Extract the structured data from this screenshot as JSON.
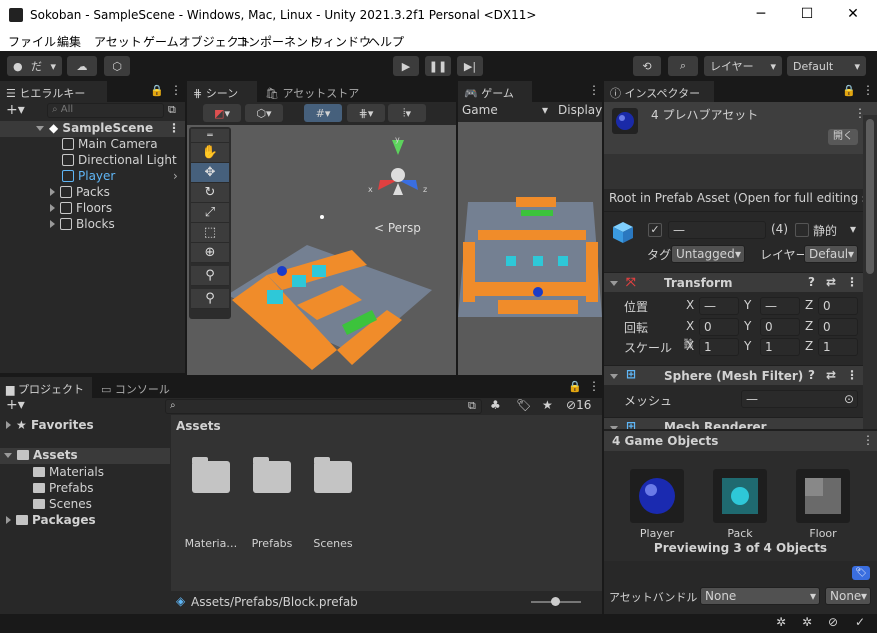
{
  "window": {
    "title": "Sokoban - SampleScene - Windows, Mac, Linux - Unity 2021.3.2f1 Personal <DX11>",
    "min": "─",
    "max": "☐",
    "close": "✕"
  },
  "menu": [
    "ファイル",
    "編集",
    "アセット",
    "ゲームオブジェクト",
    "コンポーネント",
    "ウィンドウ",
    "ヘルプ"
  ],
  "toolbar": {
    "account": "だ",
    "layers": "レイヤー",
    "layout": "Default"
  },
  "hierarchy": {
    "tab": "ヒエラルキー",
    "search_placeholder": "All",
    "scene": "SampleScene",
    "items": [
      "Main Camera",
      "Directional Light",
      "Player",
      "Packs",
      "Floors",
      "Blocks"
    ]
  },
  "scene": {
    "tab": "シーン",
    "tab2": "アセットストア",
    "persp": "< Persp",
    "gizmo_x": "x",
    "gizmo_y": "y",
    "gizmo_z": "z"
  },
  "game": {
    "tab": "ゲーム",
    "display": "Game",
    "display2": "Display"
  },
  "inspector": {
    "tab": "インスペクター",
    "title": "4 プレハブアセット",
    "open_btn": "開く",
    "root_text": "Root in Prefab Asset (Open for full editing s",
    "name_field": "—",
    "count": "(4)",
    "static_label": "静的",
    "tag_label": "タグ",
    "tag_value": "Untagged",
    "layer_label": "レイヤー",
    "layer_value": "Defaul",
    "transform": "Transform",
    "pos_label": "位置",
    "rot_label": "回転",
    "scale_label": "スケール",
    "pos": [
      "—",
      "—",
      "0"
    ],
    "rot": [
      "0",
      "0",
      "0"
    ],
    "scale": [
      "1",
      "1",
      "1"
    ],
    "x": "X",
    "y": "Y",
    "z": "Z",
    "mesh_filter": "Sphere (Mesh Filter)",
    "mesh_label": "メッシュ",
    "mesh_value": "—",
    "mesh_renderer": "Mesh Renderer",
    "preview_title": "4 Game Objects",
    "preview_items": [
      "Player",
      "Pack",
      "Floor"
    ],
    "previewing": "Previewing 3 of 4 Objects",
    "bundle_label": "アセットバンドル",
    "bundle_value": "None",
    "bundle_value2": "None"
  },
  "project": {
    "tab": "プロジェクト",
    "tab2": "コンソール",
    "badge": "16",
    "favorites": "Favorites",
    "assets": "Assets",
    "children": [
      "Materials",
      "Prefabs",
      "Scenes"
    ],
    "packages": "Packages",
    "breadcrumb": "Assets",
    "folders": [
      "Materia…",
      "Prefabs",
      "Scenes"
    ],
    "status_path": "Assets/Prefabs/Block.prefab"
  }
}
